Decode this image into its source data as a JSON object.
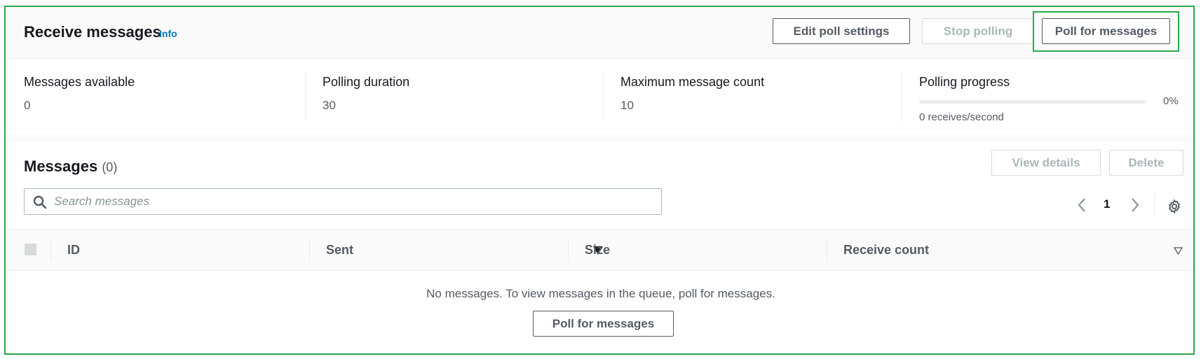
{
  "header": {
    "title": "Receive messages",
    "info_label": "Info",
    "edit_poll_label": "Edit poll settings",
    "stop_polling_label": "Stop polling",
    "poll_label": "Poll for messages"
  },
  "stats": {
    "messages_available": {
      "label": "Messages available",
      "value": "0"
    },
    "polling_duration": {
      "label": "Polling duration",
      "value": "30"
    },
    "max_message_count": {
      "label": "Maximum message count",
      "value": "10"
    },
    "polling_progress": {
      "label": "Polling progress",
      "percent_text": "0%",
      "fraction": 0,
      "rate": "0 receives/second"
    }
  },
  "messages": {
    "title": "Messages",
    "count": "(0)",
    "view_details_label": "View details",
    "delete_label": "Delete",
    "search_placeholder": "Search messages",
    "search_value": "",
    "page": "1",
    "columns": [
      "ID",
      "Sent",
      "Size",
      "Receive count"
    ],
    "empty_text": "No messages. To view messages in the queue, poll for messages.",
    "poll_label": "Poll for messages"
  },
  "icons": {
    "search": "search-icon",
    "prev": "chevron-left-icon",
    "next": "chevron-right-icon",
    "settings": "gear-icon",
    "sort_active": "caret-down-filled-icon",
    "sort_inactive": "caret-down-outline-icon"
  },
  "colors": {
    "focus": "#2aa84a",
    "link": "#0073bb",
    "text": "#16191f",
    "muted": "#545b64",
    "disabled": "#aab7b8"
  }
}
